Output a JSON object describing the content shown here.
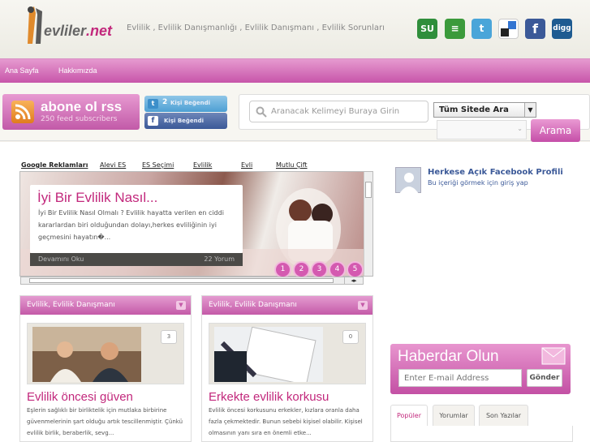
{
  "header": {
    "logo_text_a": "evliler",
    "logo_text_b": ".net",
    "tagline": "Evlilik , Evlilik Danışmanlığı , Evlilik Danışmanı , Evlilik Sorunları",
    "social": [
      {
        "name": "stumbleupon",
        "glyph": "SU",
        "color": "#2f8e3b"
      },
      {
        "name": "friendfeed",
        "glyph": "≡",
        "color": "#3b9a3b"
      },
      {
        "name": "twitter",
        "glyph": "t",
        "color": "#4aa5d9"
      },
      {
        "name": "delicious",
        "glyph": "",
        "color": "#3274d1"
      },
      {
        "name": "facebook",
        "glyph": "f",
        "color": "#3b5998"
      },
      {
        "name": "digg",
        "glyph": "digg",
        "color": "#1e5b91"
      }
    ]
  },
  "nav": {
    "home": "Ana Sayfa",
    "about": "Hakkımızda"
  },
  "rss": {
    "title": "abone ol rss",
    "count": "250",
    "subtitle": "feed subscribers"
  },
  "likes": {
    "twitter_count": "2",
    "twitter_label": "Kişi Beğendi",
    "facebook_label": "Kişi Beğendi"
  },
  "search": {
    "placeholder": "Aranacak Kelimeyi Buraya Girin",
    "scope": "Tüm Sitede Ara",
    "button": "Arama"
  },
  "ad_tabs": [
    "Google Reklamları",
    "Alevi ES",
    "ES Seçimi",
    "Evlilik",
    "Evli",
    "Mutlu Çift"
  ],
  "slider": {
    "title": "İyi Bir Evlilik Nasıl...",
    "excerpt": "İyi Bir Evlilik Nasıl Olmalı ? Evlilik hayatta verilen en ciddi kararlardan biri olduğundan dolayı,herkes evliliğinin iyi geçmesini hayatın�...",
    "read_more": "Devamını Oku",
    "comments": "22 Yorum",
    "pages": [
      "1",
      "2",
      "3",
      "4",
      "5"
    ]
  },
  "cards": [
    {
      "category": "Evlilik, Evlilik Danışmanı",
      "count": "3",
      "title": "Evlilik öncesi güven",
      "excerpt": "Eşlerin sağlıklı bir birliktelik için mutlaka birbirine güvenmelerinin şart olduğu artık tescillenmiştir. Çünkü evlilik birlik, beraberlik, sevg..."
    },
    {
      "category": "Evlilik, Evlilik Danışmanı",
      "count": "0",
      "title": "Erkekte evlilik korkusu",
      "excerpt": "Evlilik öncesi korkusunu erkekler, kızlara oranla daha fazla çekmektedir. Bunun sebebi kişisel olabilir. Kişisel olmasının yanı sıra en önemli etke..."
    }
  ],
  "facebook_box": {
    "name": "Herkese Açık Facebook Profili",
    "sub": "Bu içeriği görmek için giriş yap"
  },
  "newsletter": {
    "title": "Haberdar Olun",
    "placeholder": "Enter E-mail Address",
    "button": "Gönder"
  },
  "side_tabs": [
    "Popüler",
    "Yorumlar",
    "Son Yazılar"
  ]
}
